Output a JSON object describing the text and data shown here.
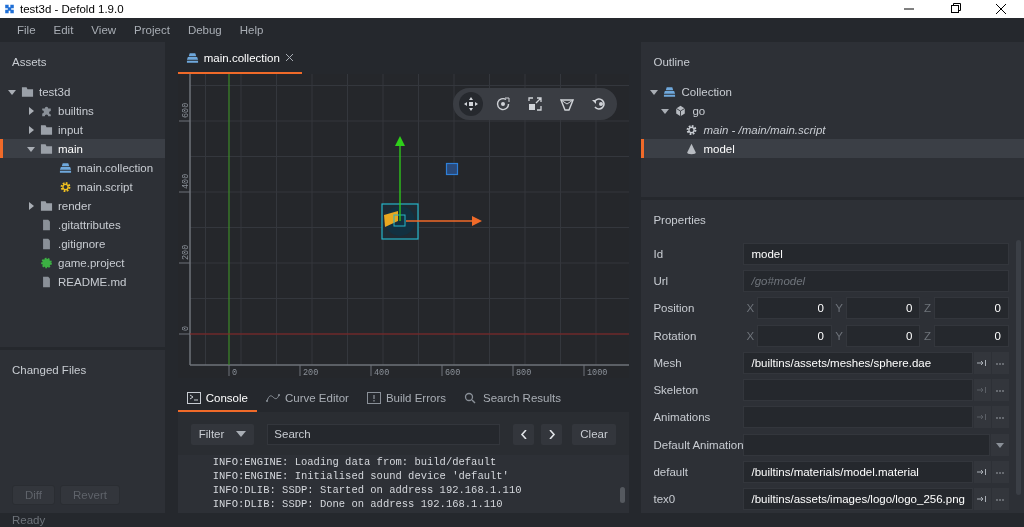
{
  "window": {
    "title": "test3d - Defold 1.9.0"
  },
  "menu": [
    "File",
    "Edit",
    "View",
    "Project",
    "Debug",
    "Help"
  ],
  "assets": {
    "title": "Assets",
    "tree": [
      {
        "label": "test3d",
        "kind": "folder",
        "expanded": true,
        "selected": false,
        "children": [
          {
            "label": "builtins",
            "kind": "puzzle",
            "expanded": false,
            "selected": false
          },
          {
            "label": "input",
            "kind": "folder",
            "expanded": false,
            "selected": false
          },
          {
            "label": "main",
            "kind": "folder",
            "expanded": true,
            "selected": true,
            "children": [
              {
                "label": "main.collection",
                "kind": "collection",
                "selected": false
              },
              {
                "label": "main.script",
                "kind": "script",
                "selected": false
              }
            ]
          },
          {
            "label": "render",
            "kind": "folder",
            "expanded": false,
            "selected": false
          },
          {
            "label": ".gitattributes",
            "kind": "file",
            "selected": false
          },
          {
            "label": ".gitignore",
            "kind": "file",
            "selected": false
          },
          {
            "label": "game.project",
            "kind": "project",
            "selected": false
          },
          {
            "label": "README.md",
            "kind": "file",
            "selected": false
          }
        ]
      }
    ]
  },
  "changed_files": {
    "title": "Changed Files",
    "buttons": [
      {
        "label": "Diff",
        "disabled": true
      },
      {
        "label": "Revert",
        "disabled": true
      }
    ]
  },
  "editor_tabs": [
    {
      "label": "main.collection",
      "selected": true
    }
  ],
  "viewport": {
    "x_ticks": [
      "0",
      "200",
      "400",
      "600",
      "800",
      "1000"
    ],
    "y_ticks": [
      "0",
      "200",
      "400",
      "600"
    ],
    "tools": [
      {
        "kind": "move",
        "selected": true
      },
      {
        "kind": "rotate",
        "selected": false
      },
      {
        "kind": "scale",
        "selected": false
      },
      {
        "kind": "perspective",
        "selected": false
      },
      {
        "kind": "reset",
        "selected": false
      }
    ]
  },
  "bottom_tabs": [
    {
      "label": "Console",
      "kind": "console",
      "selected": true
    },
    {
      "label": "Curve Editor",
      "kind": "curve",
      "selected": false
    },
    {
      "label": "Build Errors",
      "kind": "error",
      "selected": false
    },
    {
      "label": "Search Results",
      "kind": "search",
      "selected": false
    }
  ],
  "console": {
    "filter": "Filter",
    "search_placeholder": "Search",
    "clear": "Clear",
    "lines": [
      "INFO:ENGINE: Loading data from: build/default",
      "INFO:ENGINE: Initialised sound device 'default'",
      "INFO:DLIB: SSDP: Started on address 192.168.1.110",
      "INFO:DLIB: SSDP: Done on address 192.168.1.110"
    ]
  },
  "outline": {
    "title": "Outline",
    "tree": [
      {
        "label": "Collection",
        "kind": "collection",
        "expanded": true,
        "selected": false,
        "italic": false,
        "children": [
          {
            "label": "go",
            "kind": "gameobject",
            "expanded": true,
            "selected": false,
            "italic": false,
            "children": [
              {
                "label": "main - /main/main.script",
                "kind": "gear",
                "selected": false,
                "italic": true
              },
              {
                "label": "model",
                "kind": "model",
                "selected": true,
                "italic": false
              }
            ]
          }
        ]
      }
    ]
  },
  "properties": {
    "title": "Properties",
    "rows": [
      {
        "kind": "text",
        "label": "Id",
        "value": "model"
      },
      {
        "kind": "readonly",
        "label": "Url",
        "value": "/go#model"
      },
      {
        "kind": "vector",
        "label": "Position",
        "axes": [
          {
            "axis": "X",
            "value": "0"
          },
          {
            "axis": "Y",
            "value": "0"
          },
          {
            "axis": "Z",
            "value": "0"
          }
        ]
      },
      {
        "kind": "vector",
        "label": "Rotation",
        "axes": [
          {
            "axis": "X",
            "value": "0"
          },
          {
            "axis": "Y",
            "value": "0"
          },
          {
            "axis": "Z",
            "value": "0"
          }
        ]
      },
      {
        "kind": "resource",
        "label": "Mesh",
        "value": "/builtins/assets/meshes/sphere.dae",
        "disabled": false
      },
      {
        "kind": "resource",
        "label": "Skeleton",
        "disabled": true
      },
      {
        "kind": "resource",
        "label": "Animations",
        "disabled": true
      },
      {
        "kind": "dropdown",
        "label": "Default Animation"
      },
      {
        "kind": "resource",
        "label": "default",
        "value": "/builtins/materials/model.material",
        "disabled": false
      },
      {
        "kind": "resource",
        "label": "tex0",
        "value": "/builtins/assets/images/logo/logo_256.png",
        "disabled": false
      }
    ]
  },
  "status_bar": {
    "text": "Ready"
  }
}
